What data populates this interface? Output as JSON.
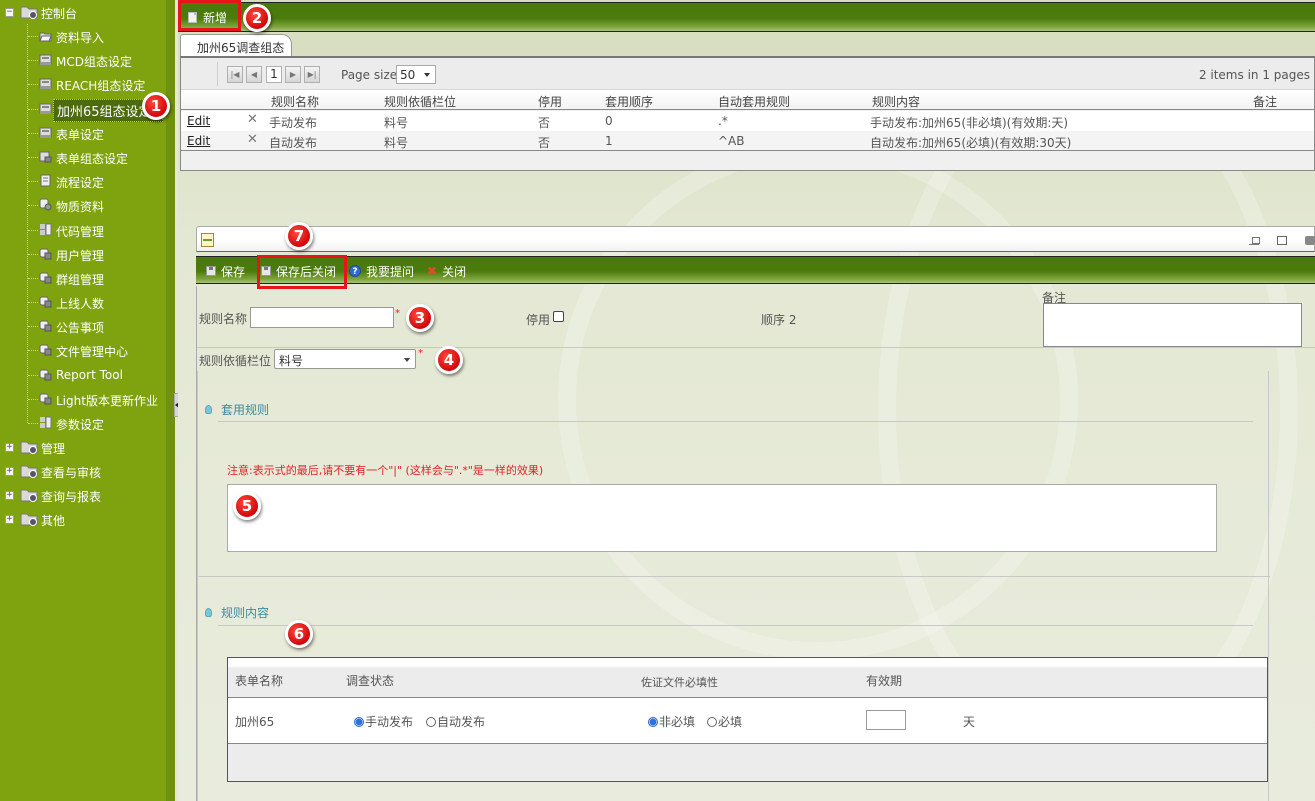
{
  "sidebar": {
    "roots": [
      {
        "label": "控制台",
        "expanded": true
      },
      {
        "label": "管理",
        "expanded": false
      },
      {
        "label": "查看与审核",
        "expanded": false
      },
      {
        "label": "查询与报表",
        "expanded": false
      },
      {
        "label": "其他",
        "expanded": false
      }
    ],
    "items": [
      {
        "label": "资料导入",
        "icon": "folder-open-icon"
      },
      {
        "label": "MCD组态设定",
        "icon": "config-icon"
      },
      {
        "label": "REACH组态设定",
        "icon": "config-icon"
      },
      {
        "label": "加州65组态设定",
        "icon": "config-icon",
        "selected": true
      },
      {
        "label": "表单设定",
        "icon": "config-icon"
      },
      {
        "label": "表单组态设定",
        "icon": "form-config-icon"
      },
      {
        "label": "流程设定",
        "icon": "flow-icon"
      },
      {
        "label": "物质资料",
        "icon": "substance-icon"
      },
      {
        "label": "代码管理",
        "icon": "code-icon"
      },
      {
        "label": "用户管理",
        "icon": "user-icon"
      },
      {
        "label": "群组管理",
        "icon": "group-icon"
      },
      {
        "label": "上线人数",
        "icon": "online-icon"
      },
      {
        "label": "公告事项",
        "icon": "notice-icon"
      },
      {
        "label": "文件管理中心",
        "icon": "file-center-icon"
      },
      {
        "label": "Report Tool",
        "icon": "report-icon"
      },
      {
        "label": "Light版本更新作业",
        "icon": "update-icon"
      },
      {
        "label": "参数设定",
        "icon": "param-icon"
      }
    ]
  },
  "annotations": [
    "1",
    "2",
    "3",
    "4",
    "5",
    "6",
    "7"
  ],
  "toolbar": {
    "add_label": "新增"
  },
  "tab": {
    "label": "加州65调查组态"
  },
  "grid": {
    "pager": {
      "first": "⏮",
      "prev": "◀",
      "current_page": "1",
      "next": "▶",
      "last": "⏭",
      "page_size_label": "Page size:",
      "page_size": "50",
      "info": "2 items in 1 pages"
    },
    "columns": [
      "规则名称",
      "规则依循栏位",
      "停用",
      "套用顺序",
      "自动套用规则",
      "规则内容",
      "备注"
    ],
    "rows": [
      {
        "edit": "Edit",
        "name": "手动发布",
        "field": "料号",
        "disabled": "否",
        "order": "0",
        "auto_rule": ".*",
        "content": "手动发布:加州65(非必填)(有效期:天)",
        "note": ""
      },
      {
        "edit": "Edit",
        "name": "自动发布",
        "field": "料号",
        "disabled": "否",
        "order": "1",
        "auto_rule": "^AB",
        "content": "自动发布:加州65(必填)(有效期:30天)",
        "note": ""
      }
    ]
  },
  "dialog": {
    "toolbar": {
      "save": "保存",
      "save_close": "保存后关闭",
      "ask": "我要提问",
      "close": "关闭"
    },
    "form": {
      "rule_name_label": "规则名称",
      "rule_name_value": "",
      "disabled_label": "停用",
      "disabled_checked": false,
      "order_label": "顺序 2",
      "note_label": "备注",
      "field_label": "规则依循栏位",
      "field_value": "料号",
      "required_mark": "*"
    },
    "apply_rule": {
      "title": "套用规则",
      "warning": "注意:表示式的最后,请不要有一个\"|\" (这样会与\".*\"是一样的效果)",
      "expression": ""
    },
    "rule_content": {
      "title": "规则内容",
      "columns": [
        "表单名称",
        "调查状态",
        "佐证文件必填性",
        "有效期"
      ],
      "row": {
        "form_name": "加州65",
        "status_options": [
          "手动发布",
          "自动发布"
        ],
        "status_selected": "手动发布",
        "required_options": [
          "非必填",
          "必填"
        ],
        "required_selected": "非必填",
        "validity_value": "",
        "validity_unit": "天"
      }
    }
  },
  "colors": {
    "sidebar_bg": "#7fa30f",
    "toolbar_green": "#4a7a0c",
    "highlight_red": "#e8141c",
    "required_red": "#e0222a",
    "section_teal": "#3c8aa0"
  }
}
